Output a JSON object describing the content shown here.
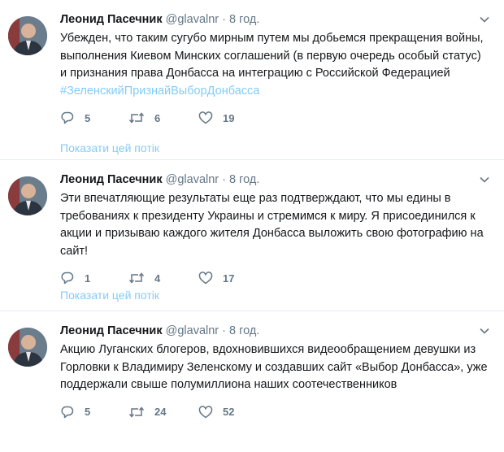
{
  "tweets": [
    {
      "author": "Леонид Пасечник",
      "handle": "@glavalnr",
      "separator": "·",
      "time": "8 год.",
      "text": "Убежден, что таким сугубо мирным путем мы добьемся прекращения войны, выполнения Киевом Минских соглашений (в первую очередь особый статус) и признания права Донбасса на интеграцию с Российской Федерацией",
      "hashtag": "#ЗеленскийПризнайВыборДонбасса",
      "replies": "5",
      "retweets": "6",
      "likes": "19",
      "thread_link": "Показати цей потік"
    },
    {
      "author": "Леонид Пасечник",
      "handle": "@glavalnr",
      "separator": "·",
      "time": "8 год.",
      "text": "Эти впечатляющие результаты еще раз подтверждают, что мы едины в требованиях к президенту Украины и стремимся к миру. Я присоединился к акции и призываю каждого жителя Донбасса выложить свою фотографию на сайт!",
      "replies": "1",
      "retweets": "4",
      "likes": "17",
      "thread_link": "Показати цей потік"
    },
    {
      "author": "Леонид Пасечник",
      "handle": "@glavalnr",
      "separator": "·",
      "time": "8 год.",
      "text": "Акцию Луганских блогеров, вдохновившихся видеообращением девушки из Горловки к Владимиру Зеленскому и создавших сайт «Выбор Донбасса», уже поддержали свыше полумиллиона наших соотечественников",
      "replies": "5",
      "retweets": "24",
      "likes": "52"
    }
  ],
  "icons": {
    "reply": "reply-icon",
    "retweet": "retweet-icon",
    "like": "heart-icon",
    "menu": "chevron-down-icon"
  },
  "colors": {
    "link": "#1da1f2",
    "muted": "#657786",
    "divider": "#e6ecf0"
  }
}
